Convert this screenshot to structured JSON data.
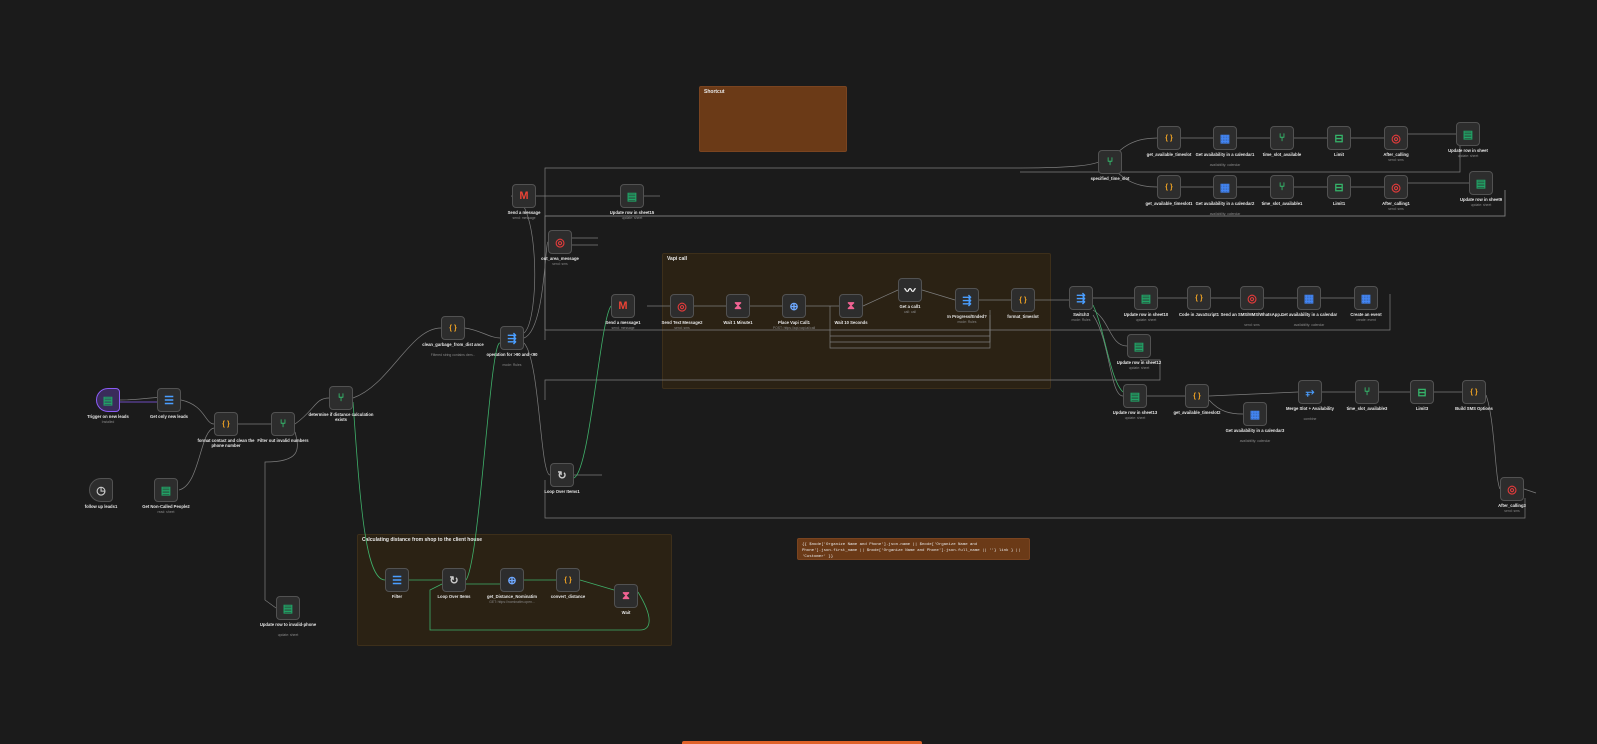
{
  "stickies": [
    {
      "title": "Shortcut",
      "color": "#6b3a17"
    },
    {
      "title": "Vapi call",
      "color": "#2b2214"
    },
    {
      "title": "Calculating distance from shop to the client house",
      "color": "#2b2214"
    },
    {
      "title": "",
      "color": "#6b3a17"
    }
  ],
  "note_text": "{{ $node['Organize Name and Phone'].json.name || $node['Organize Name and Phone'].json.first_name || $node['Organize Name and Phone'].json.full_name || ''} link } || 'Customer' }}",
  "nodes": [
    {
      "label": "Trigger on new leads",
      "sub": "Installed",
      "icon": "sheets-icon",
      "glyph": "▤",
      "color": "#21a366"
    },
    {
      "label": "Get only new leads",
      "sub": "",
      "icon": "filter-icon",
      "glyph": "☰",
      "color": "#4a9eff"
    },
    {
      "label": "format contact and clean the phone number",
      "sub": "",
      "icon": "code-icon",
      "glyph": "{ }",
      "color": "#f5a623"
    },
    {
      "label": "Filter out invalid numbers",
      "sub": "",
      "icon": "if-icon",
      "glyph": "⑂",
      "color": "#35b46a"
    },
    {
      "label": "determine if distance calculation exists",
      "sub": "",
      "icon": "if-icon",
      "glyph": "⑂",
      "color": "#35b46a"
    },
    {
      "label": "clean_garbage_from_dist ance",
      "sub": "Filtered string contains dem...",
      "icon": "code-icon",
      "glyph": "{ }",
      "color": "#f5a623"
    },
    {
      "label": "operation for >90 and <90",
      "sub": "mode: Rules",
      "icon": "switch-icon",
      "glyph": "⇶",
      "color": "#4a9eff"
    },
    {
      "label": "Send a message",
      "sub": "send: message",
      "icon": "gmail-icon",
      "glyph": "M",
      "color": "#ea4335"
    },
    {
      "label": "Update row in sheet15",
      "sub": "update: sheet",
      "icon": "sheets-icon",
      "glyph": "▤",
      "color": "#21a366"
    },
    {
      "label": "out_area_message",
      "sub": "send: sms",
      "icon": "twilio-icon",
      "glyph": "◎",
      "color": "#e23b3b"
    },
    {
      "label": "Loop Over Items1",
      "sub": "",
      "icon": "loop-icon",
      "glyph": "↻",
      "color": "#cccccc"
    },
    {
      "label": "Send a message1",
      "sub": "send: message",
      "icon": "gmail-icon",
      "glyph": "M",
      "color": "#ea4335"
    },
    {
      "label": "Send Text Message2",
      "sub": "send: sms",
      "icon": "twilio-icon",
      "glyph": "◎",
      "color": "#e23b3b"
    },
    {
      "label": "Wait 1 Minute1",
      "sub": "",
      "icon": "wait-icon",
      "glyph": "⧗",
      "color": "#f06292"
    },
    {
      "label": "Place Vapi Call1",
      "sub": "POST: https://api.vapi.ai/call",
      "icon": "http-icon",
      "glyph": "⊕",
      "color": "#6ea8ff"
    },
    {
      "label": "Wait 10 Seconds",
      "sub": "",
      "icon": "wait-icon",
      "glyph": "⧗",
      "color": "#f06292"
    },
    {
      "label": "Get a call1",
      "sub": "call: call",
      "icon": "vapi-icon",
      "glyph": "〰",
      "color": "#ffffff"
    },
    {
      "label": "In Progress/Ended?",
      "sub": "mode: Rules",
      "icon": "switch-icon",
      "glyph": "⇶",
      "color": "#4a9eff"
    },
    {
      "label": "format_timeslot",
      "sub": "",
      "icon": "code-icon",
      "glyph": "{ }",
      "color": "#f5a623"
    },
    {
      "label": "Switch3",
      "sub": "mode: Rules",
      "icon": "switch-icon",
      "glyph": "⇶",
      "color": "#4a9eff"
    },
    {
      "label": "specified_time_slot",
      "sub": "",
      "icon": "if-icon",
      "glyph": "⑂",
      "color": "#35b46a"
    },
    {
      "label": "get_available_timeslot",
      "sub": "",
      "icon": "code-icon",
      "glyph": "{ }",
      "color": "#f5a623"
    },
    {
      "label": "Get availability in a calendar1",
      "sub": "availability: calendar",
      "icon": "calendar-icon",
      "glyph": "▦",
      "color": "#4285f4"
    },
    {
      "label": "time_slot_available",
      "sub": "",
      "icon": "if-icon",
      "glyph": "⑂",
      "color": "#35b46a"
    },
    {
      "label": "Limit",
      "sub": "",
      "icon": "limit-icon",
      "glyph": "⊟",
      "color": "#35b46a"
    },
    {
      "label": "After_calling",
      "sub": "send: sms",
      "icon": "twilio-icon",
      "glyph": "◎",
      "color": "#e23b3b"
    },
    {
      "label": "Update row in sheet",
      "sub": "update: sheet",
      "icon": "sheets-icon",
      "glyph": "▤",
      "color": "#21a366"
    },
    {
      "label": "get_available_timeslot1",
      "sub": "",
      "icon": "code-icon",
      "glyph": "{ }",
      "color": "#f5a623"
    },
    {
      "label": "Get availability in a calendar2",
      "sub": "availability: calendar",
      "icon": "calendar-icon",
      "glyph": "▦",
      "color": "#4285f4"
    },
    {
      "label": "time_slot_available1",
      "sub": "",
      "icon": "if-icon",
      "glyph": "⑂",
      "color": "#35b46a"
    },
    {
      "label": "Limit1",
      "sub": "",
      "icon": "limit-icon",
      "glyph": "⊟",
      "color": "#35b46a"
    },
    {
      "label": "After_calling1",
      "sub": "send: sms",
      "icon": "twilio-icon",
      "glyph": "◎",
      "color": "#e23b3b"
    },
    {
      "label": "Update row in sheet9",
      "sub": "update: sheet",
      "icon": "sheets-icon",
      "glyph": "▤",
      "color": "#21a366"
    },
    {
      "label": "Update row in sheet10",
      "sub": "update: sheet",
      "icon": "sheets-icon",
      "glyph": "▤",
      "color": "#21a366"
    },
    {
      "label": "Code in JavaScript1",
      "sub": "",
      "icon": "code-icon",
      "glyph": "{ }",
      "color": "#f5a623"
    },
    {
      "label": "Send an SMS/MMS/WhatsApp...",
      "sub": "send: sms",
      "icon": "twilio-icon",
      "glyph": "◎",
      "color": "#e23b3b"
    },
    {
      "label": "Get availability in a calendar",
      "sub": "availability: calendar",
      "icon": "calendar-icon",
      "glyph": "▦",
      "color": "#4285f4"
    },
    {
      "label": "Create an event",
      "sub": "create: event",
      "icon": "calendar-icon",
      "glyph": "▦",
      "color": "#4285f4"
    },
    {
      "label": "Update row in sheet12",
      "sub": "update: sheet",
      "icon": "sheets-icon",
      "glyph": "▤",
      "color": "#21a366"
    },
    {
      "label": "Update row in sheet13",
      "sub": "update: sheet",
      "icon": "sheets-icon",
      "glyph": "▤",
      "color": "#21a366"
    },
    {
      "label": "get_available_timeslot2",
      "sub": "",
      "icon": "code-icon",
      "glyph": "{ }",
      "color": "#f5a623"
    },
    {
      "label": "Get availability in a calendar3",
      "sub": "availability: calendar",
      "icon": "calendar-icon",
      "glyph": "▦",
      "color": "#4285f4"
    },
    {
      "label": "Merge Slot + Availability",
      "sub": "combine",
      "icon": "merge-icon",
      "glyph": "⥅",
      "color": "#4a9eff"
    },
    {
      "label": "time_slot_available3",
      "sub": "",
      "icon": "if-icon",
      "glyph": "⑂",
      "color": "#35b46a"
    },
    {
      "label": "Limit3",
      "sub": "",
      "icon": "limit-icon",
      "glyph": "⊟",
      "color": "#35b46a"
    },
    {
      "label": "Build SMS Options",
      "sub": "",
      "icon": "code-icon",
      "glyph": "{ }",
      "color": "#f5a623"
    },
    {
      "label": "After_calling3",
      "sub": "send: sms",
      "icon": "twilio-icon",
      "glyph": "◎",
      "color": "#e23b3b"
    },
    {
      "label": "follow up leads1",
      "sub": "",
      "icon": "clock-icon",
      "glyph": "◷",
      "color": "#cccccc"
    },
    {
      "label": "Get Non-Called People2",
      "sub": "read: sheet",
      "icon": "sheets-icon",
      "glyph": "▤",
      "color": "#21a366"
    },
    {
      "label": "Update row to invalid-phone",
      "sub": "update: sheet",
      "icon": "sheets-icon",
      "glyph": "▤",
      "color": "#21a366"
    },
    {
      "label": "Filter",
      "sub": "",
      "icon": "filter-icon",
      "glyph": "☰",
      "color": "#4a9eff"
    },
    {
      "label": "Loop Over Items",
      "sub": "",
      "icon": "loop-icon",
      "glyph": "↻",
      "color": "#cccccc"
    },
    {
      "label": "get_Distance_Nominatim",
      "sub": "GET: https://nominatim.open...",
      "icon": "http-icon",
      "glyph": "⊕",
      "color": "#6ea8ff"
    },
    {
      "label": "convert_distance",
      "sub": "",
      "icon": "code-icon",
      "glyph": "{ }",
      "color": "#f5a623"
    },
    {
      "label": "Wait",
      "sub": "",
      "icon": "wait-icon",
      "glyph": "⧗",
      "color": "#f06292"
    }
  ]
}
